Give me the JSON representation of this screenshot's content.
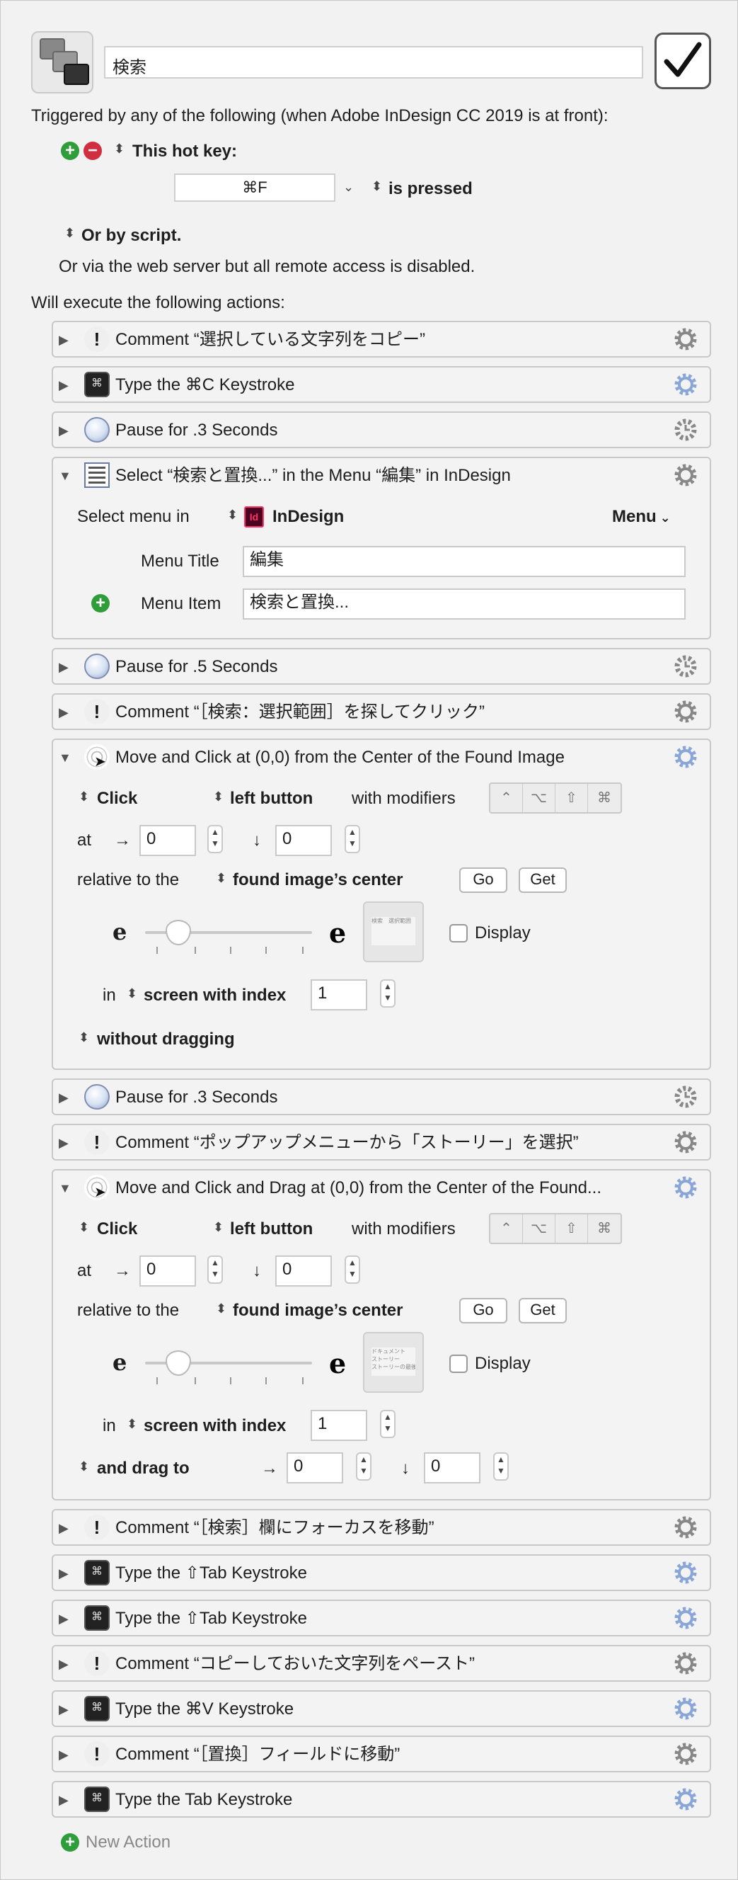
{
  "header": {
    "title_value": "検索",
    "enabled": true,
    "triggered_text": "Triggered by any of the following (when Adobe InDesign CC 2019 is at front):",
    "hotkey_label": "This hot key:",
    "hotkey_value": "⌘F",
    "hotkey_state": "is pressed",
    "script_label": "Or by script.",
    "web_server_text": "Or via the web server but all remote access is disabled.",
    "execute_text": "Will execute the following actions:"
  },
  "actions": [
    {
      "type": "comment",
      "label": "Comment “選択している文字列をコピー”"
    },
    {
      "type": "keystroke",
      "label": "Type the ⌘C Keystroke"
    },
    {
      "type": "pause",
      "label": "Pause for .3 Seconds"
    },
    {
      "type": "menu",
      "label": "Select “検索と置換...” in the Menu “編集” in InDesign"
    },
    {
      "type": "pause",
      "label": "Pause for .5 Seconds"
    },
    {
      "type": "comment",
      "label": "Comment “［検索：選択範囲］を探してクリック”"
    },
    {
      "type": "click",
      "label": "Move and Click at (0,0) from the Center of the Found Image"
    },
    {
      "type": "pause",
      "label": "Pause for .3 Seconds"
    },
    {
      "type": "comment",
      "label": "Comment “ポップアップメニューから「ストーリー」を選択”"
    },
    {
      "type": "click",
      "label": "Move and Click and Drag at (0,0) from the Center of the Found..."
    },
    {
      "type": "comment",
      "label": "Comment “［検索］欄にフォーカスを移動”"
    },
    {
      "type": "keystroke",
      "label": "Type the ⇧Tab Keystroke"
    },
    {
      "type": "keystroke",
      "label": "Type the ⇧Tab Keystroke"
    },
    {
      "type": "comment",
      "label": "Comment “コピーしておいた文字列をペースト”"
    },
    {
      "type": "keystroke",
      "label": "Type the ⌘V Keystroke"
    },
    {
      "type": "comment",
      "label": "Comment “［置換］フィールドに移動”"
    },
    {
      "type": "keystroke",
      "label": "Type the Tab Keystroke"
    }
  ],
  "menu_action": {
    "select_menu_in": "Select menu in",
    "app": "InDesign",
    "app_badge": "Id",
    "menu_dropdown": "Menu",
    "menu_title_label": "Menu Title",
    "menu_title_value": "編集",
    "menu_item_label": "Menu Item",
    "menu_item_value": "検索と置換..."
  },
  "click1": {
    "click_label": "Click",
    "button_label": "left button",
    "with_modifiers": "with modifiers",
    "at_label": "at",
    "arrow_right": "→",
    "arrow_down": "↓",
    "x_value": "0",
    "y_value": "0",
    "relative_label": "relative to the",
    "relative_value": "found image’s center",
    "go_label": "Go",
    "get_label": "Get",
    "display_label": "Display",
    "in_label": "in",
    "screen_label": "screen with index",
    "screen_index": "1",
    "drag_label": "without dragging",
    "fuzz_left": "e",
    "fuzz_right": "e",
    "fuzziness_fraction": 0.2,
    "thumb_text": "検索　選択範囲"
  },
  "click2": {
    "click_label": "Click",
    "button_label": "left button",
    "with_modifiers": "with modifiers",
    "at_label": "at",
    "arrow_right": "→",
    "arrow_down": "↓",
    "x_value": "0",
    "y_value": "0",
    "relative_label": "relative to the",
    "relative_value": "found image’s center",
    "go_label": "Go",
    "get_label": "Get",
    "display_label": "Display",
    "in_label": "in",
    "screen_label": "screen with index",
    "screen_index": "1",
    "drag_label": "and drag to",
    "drag_x": "0",
    "drag_y": "0",
    "fuzz_left": "e",
    "fuzz_right": "e",
    "fuzziness_fraction": 0.2,
    "thumb_text": "ドキュメント\nストーリー\nストーリーの最後"
  },
  "modifiers": [
    "⌃",
    "⌥",
    "⇧",
    "⌘"
  ],
  "new_action_label": "New Action",
  "icons": {
    "comment": "exclamation-icon",
    "keystroke": "keyboard-key-icon",
    "pause": "clock-icon",
    "menu": "menu-list-icon",
    "click": "click-target-icon",
    "gear": "gear-icon"
  }
}
